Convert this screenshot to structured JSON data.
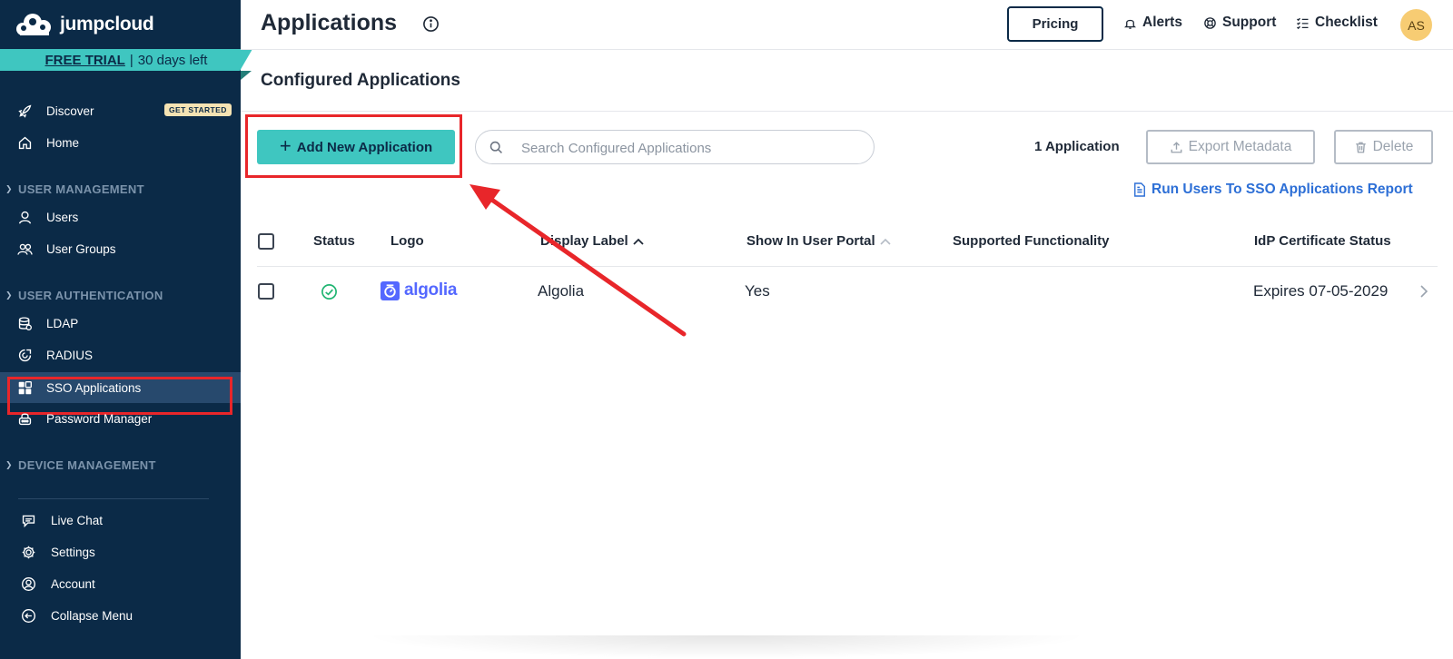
{
  "brand": {
    "name": "jumpcloud"
  },
  "trial": {
    "link": "FREE TRIAL",
    "separator": "|",
    "days": "30 days left"
  },
  "sidebar": {
    "discover": {
      "label": "Discover",
      "badge": "GET STARTED"
    },
    "home": {
      "label": "Home"
    },
    "sections": {
      "user_management": "USER MANAGEMENT",
      "user_authentication": "USER AUTHENTICATION",
      "device_management": "DEVICE MANAGEMENT"
    },
    "users": {
      "label": "Users"
    },
    "user_groups": {
      "label": "User Groups"
    },
    "ldap": {
      "label": "LDAP"
    },
    "radius": {
      "label": "RADIUS"
    },
    "sso_applications": {
      "label": "SSO Applications"
    },
    "password_manager": {
      "label": "Password Manager"
    },
    "live_chat": {
      "label": "Live Chat"
    },
    "settings": {
      "label": "Settings"
    },
    "account": {
      "label": "Account"
    },
    "collapse_menu": {
      "label": "Collapse Menu"
    }
  },
  "header": {
    "title": "Applications",
    "pricing": "Pricing",
    "alerts": "Alerts",
    "support": "Support",
    "checklist": "Checklist",
    "avatar_initials": "AS"
  },
  "main": {
    "section_title": "Configured Applications",
    "add_button": "Add New Application",
    "search_placeholder": "Search Configured Applications",
    "app_count": "1 Application",
    "export_button": "Export Metadata",
    "delete_button": "Delete",
    "report_link": "Run Users To SSO Applications Report"
  },
  "table": {
    "columns": {
      "status": "Status",
      "logo": "Logo",
      "display_label": "Display Label",
      "show_in_user_portal": "Show In User Portal",
      "supported_functionality": "Supported Functionality",
      "idp_certificate_status": "IdP Certificate Status"
    },
    "rows": [
      {
        "logo_text": "algolia",
        "display_label": "Algolia",
        "show_in_user_portal": "Yes",
        "supported_functionality": "",
        "idp_certificate_status": "Expires 07-05-2029"
      }
    ]
  },
  "colors": {
    "sidebar_bg": "#0b2a47",
    "accent_teal": "#3fc6c0",
    "annotation_red": "#e8262a",
    "link_blue": "#2d6fd6",
    "algolia_blue": "#5468ff",
    "status_green": "#22b573"
  }
}
